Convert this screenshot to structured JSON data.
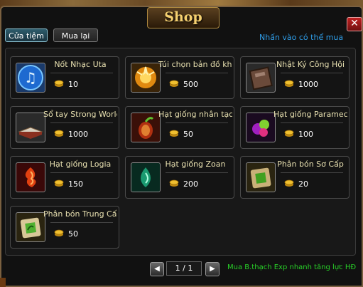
{
  "window": {
    "title": "Shop",
    "close_label": "✕"
  },
  "tabs": [
    {
      "label": "Cửa tiệm",
      "active": true
    },
    {
      "label": "Mua lại",
      "active": false
    }
  ],
  "hint": "Nhấn vào có thể mua",
  "items": [
    {
      "name": "Nốt Nhạc Uta",
      "price": "10",
      "icon": "music-note-icon"
    },
    {
      "name": "Túi chọn bản đồ kho báu",
      "price": "500",
      "icon": "treasure-bag-icon"
    },
    {
      "name": "Nhật Ký Công Hội",
      "price": "1000",
      "icon": "journal-book-icon"
    },
    {
      "name": "Sổ tay Strong World",
      "price": "1000",
      "icon": "open-book-icon"
    },
    {
      "name": "Hạt giống nhân tạo",
      "price": "50",
      "icon": "artificial-seed-icon"
    },
    {
      "name": "Hạt giống Paramecia",
      "price": "100",
      "icon": "paramecia-seed-icon"
    },
    {
      "name": "Hạt giống Logia",
      "price": "150",
      "icon": "logia-seed-icon"
    },
    {
      "name": "Hạt giống Zoan",
      "price": "200",
      "icon": "zoan-seed-icon"
    },
    {
      "name": "Phân bón Sơ Cấp",
      "price": "20",
      "icon": "basic-fertilizer-icon"
    },
    {
      "name": "Phân bón Trung Cấp",
      "price": "50",
      "icon": "intermediate-fertilizer-icon"
    }
  ],
  "pagination": {
    "text": "1 / 1",
    "prev_label": "◀",
    "next_label": "▶"
  },
  "promo": "Mua B.thạch Exp nhanh tăng lực HĐ",
  "colors": {
    "hint": "#2f9de8",
    "promo": "#28d028",
    "title": "#f5d070"
  }
}
